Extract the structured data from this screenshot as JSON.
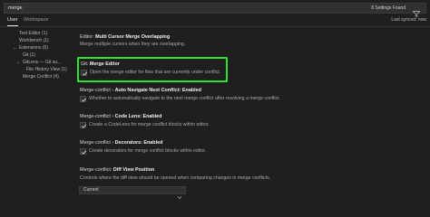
{
  "search": {
    "value": "merge",
    "results": "8 Settings Found"
  },
  "tabs": [
    {
      "label": "User"
    },
    {
      "label": "Workspace"
    }
  ],
  "last_synced": "Last synced: now",
  "toc": [
    {
      "label": "Text Editor (1)"
    },
    {
      "label": "Workbench (1)"
    },
    {
      "label": "Extensions (6)"
    },
    {
      "label": "Git (1)"
    },
    {
      "label": "GitLens — Git su..."
    },
    {
      "label": "File History View (1)"
    },
    {
      "label": "Merge Conflict (4)"
    }
  ],
  "settings": [
    {
      "category": "Editor: ",
      "name": "Multi Cursor Merge Overlapping",
      "description": "Merge multiple cursors when they are overlapping."
    },
    {
      "category": "Git: ",
      "name": "Merge Editor",
      "description": "Open the merge editor for files that are currently under conflict."
    },
    {
      "category": "Merge-conflict › ",
      "name": "Auto Navigate Next Conflict: Enabled",
      "description": "Whether to automatically navigate to the next merge conflict after resolving a merge conflict."
    },
    {
      "category": "Merge-conflict › ",
      "name": "Code Lens: Enabled",
      "description": "Create a CodeLens for merge conflict blocks within editor."
    },
    {
      "category": "Merge-conflict › ",
      "name": "Decorators: Enabled",
      "description": "Create decorators for merge conflict blocks within editor."
    },
    {
      "category": "Merge-conflict: ",
      "name": "Diff View Position",
      "description": "Controls where the diff view should be opened when comparing changes in merge conflicts.",
      "select_value": "Current"
    }
  ],
  "colors": {
    "highlight": "#2ee62e",
    "background": "#1f1f1f"
  }
}
